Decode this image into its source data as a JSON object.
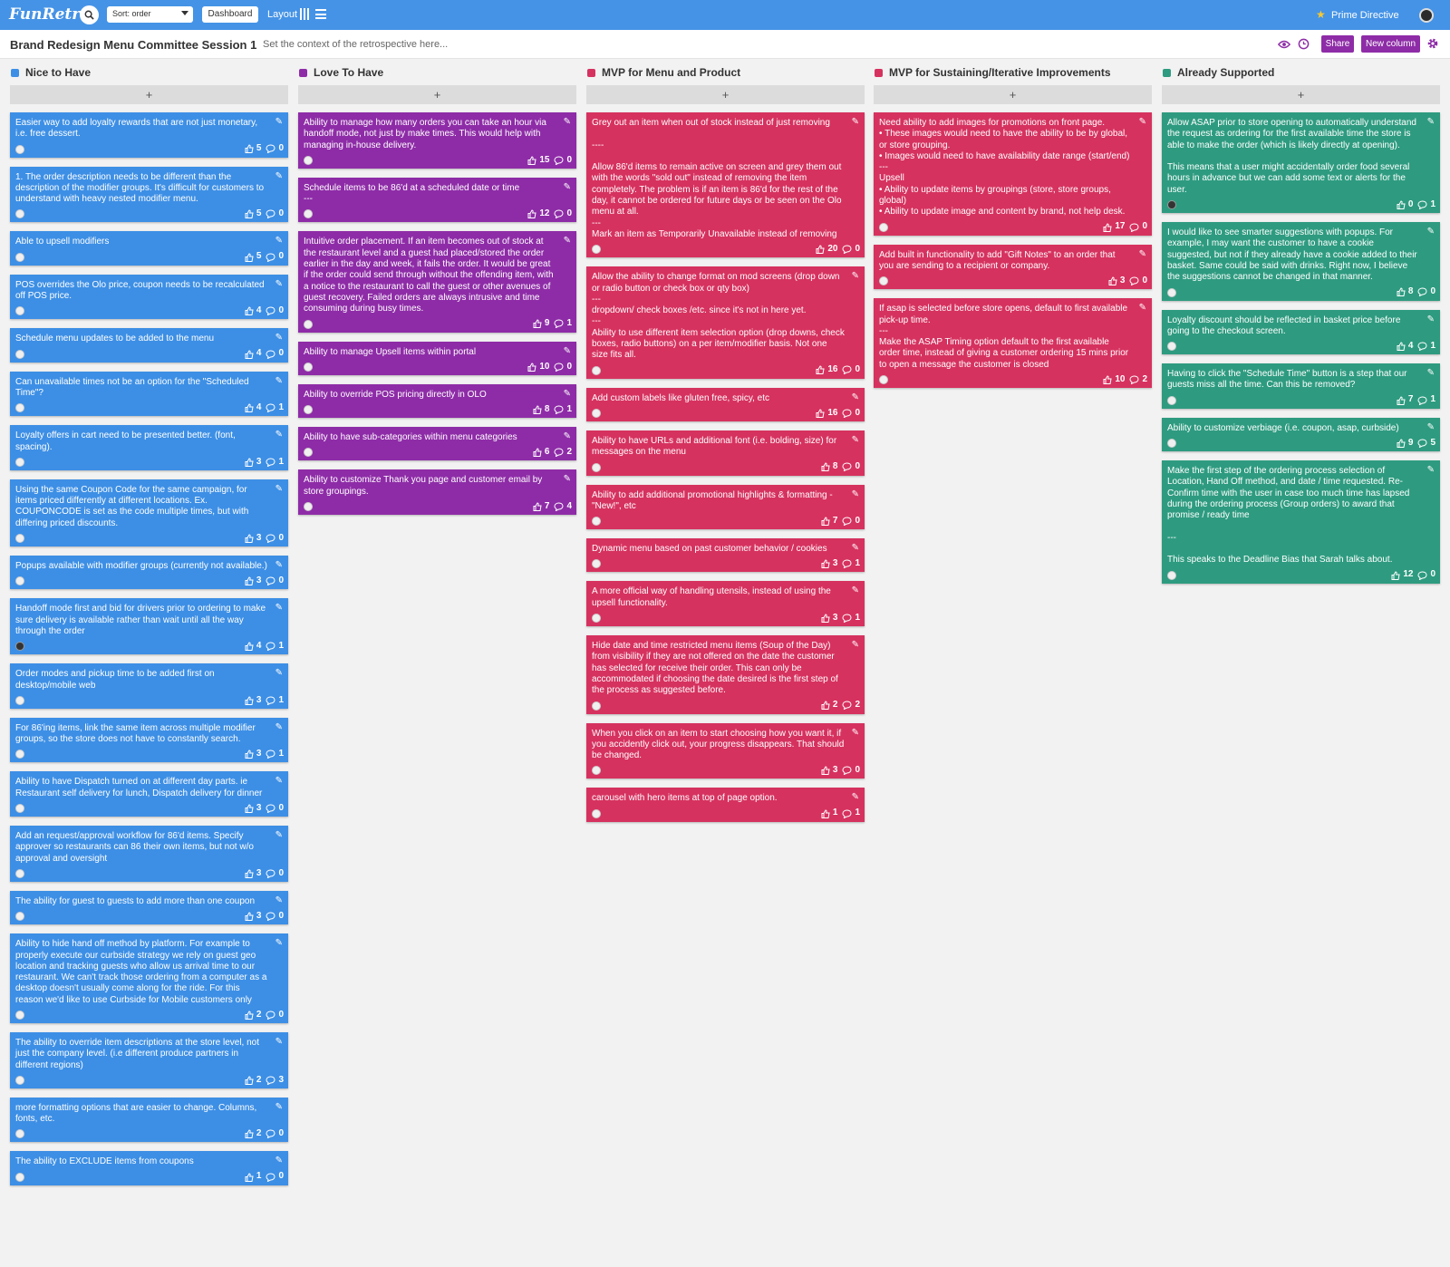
{
  "header": {
    "logo": "FunRetro",
    "sort_value": "Sort: order",
    "dashboard_label": "Dashboard",
    "layout_label": "Layout",
    "prime_directive": "Prime Directive"
  },
  "board": {
    "title": "Brand Redesign Menu Committee Session 1",
    "context_placeholder": "Set the context of the retrospective here...",
    "share_label": "Share",
    "new_column_label": "New column"
  },
  "colors": {
    "topbar": "#4593e6",
    "blue_card": "#3d8fe5",
    "purple_card": "#8e2ca7",
    "pink_card": "#d6325f",
    "teal_card": "#2e9b80"
  },
  "icons": {
    "search": "search-icon",
    "layout_columns": "columns-icon",
    "layout_rows": "rows-icon",
    "star": "star-icon",
    "eye": "eye-icon",
    "clock": "clock-icon",
    "gear": "gear-icon",
    "pencil": "pencil-icon",
    "like": "thumbs-up-icon",
    "comment": "comment-icon"
  },
  "columns": [
    {
      "title": "Nice to Have",
      "color": "#3d8fe5",
      "add_label": "+",
      "cards": [
        {
          "text": "Easier way to add loyalty rewards that are not just monetary, i.e. free dessert.",
          "likes": "5",
          "comments": "0"
        },
        {
          "text": "1. The order description needs to be different than the description of the modifier groups. It's difficult for customers to understand with heavy nested modifier menu.",
          "likes": "5",
          "comments": "0"
        },
        {
          "text": "Able to upsell modifiers",
          "likes": "5",
          "comments": "0"
        },
        {
          "text": "POS overrides the Olo price, coupon needs to be recalculated off POS price.",
          "likes": "4",
          "comments": "0"
        },
        {
          "text": "Schedule menu updates to be added to the menu",
          "likes": "4",
          "comments": "0"
        },
        {
          "text": "Can unavailable times not be an option for the \"Scheduled Time\"?",
          "likes": "4",
          "comments": "1"
        },
        {
          "text": "Loyalty offers in cart need to be presented better. (font, spacing).",
          "likes": "3",
          "comments": "1"
        },
        {
          "text": "Using the same Coupon Code for the same campaign, for items priced differently at different locations. Ex. COUPONCODE is set as the code multiple times, but with differing priced discounts.",
          "likes": "3",
          "comments": "0"
        },
        {
          "text": "Popups available with modifier groups (currently not available.)",
          "likes": "3",
          "comments": "0"
        },
        {
          "text": "Handoff mode first and bid for drivers prior to ordering to make sure delivery is available rather than wait until all the way through the order",
          "likes": "4",
          "comments": "1",
          "dark_avatar": true
        },
        {
          "text": "Order modes and pickup time to be added first on desktop/mobile web",
          "likes": "3",
          "comments": "1"
        },
        {
          "text": "For 86'ing items, link the same item across multiple modifier groups, so the store does not have to constantly search.",
          "likes": "3",
          "comments": "1"
        },
        {
          "text": "Ability to have Dispatch turned on at different day parts. ie Restaurant self delivery for lunch, Dispatch delivery for dinner",
          "likes": "3",
          "comments": "0"
        },
        {
          "text": "Add an request/approval workflow for 86'd items. Specify approver so restaurants can 86 their own items, but not w/o approval and oversight",
          "likes": "3",
          "comments": "0"
        },
        {
          "text": "The ability for guest to guests to add more than one coupon",
          "likes": "3",
          "comments": "0"
        },
        {
          "text": "Ability to hide hand off method by platform. For example to properly execute our curbside strategy we rely on guest geo location and tracking guests who allow us arrival time to our restaurant. We can't track those ordering from a computer as a desktop doesn't usually come along for the ride. For this reason we'd like to use Curbside for Mobile customers only",
          "likes": "2",
          "comments": "0"
        },
        {
          "text": "The ability to override item descriptions at the store level, not just the company level. (i.e different produce partners in different regions)",
          "likes": "2",
          "comments": "3"
        },
        {
          "text": "more formatting options that are easier to change. Columns, fonts, etc.",
          "likes": "2",
          "comments": "0"
        },
        {
          "text": "The ability to EXCLUDE items from coupons",
          "likes": "1",
          "comments": "0"
        }
      ]
    },
    {
      "title": "Love To Have",
      "color": "#8e2ca7",
      "add_label": "+",
      "cards": [
        {
          "text": "Ability to manage how many orders you can take an hour via handoff mode, not just by make times. This would help with managing in-house delivery.",
          "likes": "15",
          "comments": "0"
        },
        {
          "text": "Schedule items to be 86'd at a scheduled date or time\n---",
          "likes": "12",
          "comments": "0"
        },
        {
          "text": "Intuitive order placement. If an item becomes out of stock at the restaurant level and a guest had placed/stored the order earlier in the day and week, it fails the order. It would be great if the order could send through without the offending item, with a notice to the restaurant to call the guest or other avenues of guest recovery. Failed orders are always intrusive and time consuming during busy times.",
          "likes": "9",
          "comments": "1"
        },
        {
          "text": "Ability to manage Upsell items within portal",
          "likes": "10",
          "comments": "0"
        },
        {
          "text": "Ability to override POS pricing directly in OLO",
          "likes": "8",
          "comments": "1"
        },
        {
          "text": "Ability to have sub-categories within menu categories",
          "likes": "6",
          "comments": "2"
        },
        {
          "text": "Ability to customize Thank you page and customer email by store groupings.",
          "likes": "7",
          "comments": "4"
        }
      ]
    },
    {
      "title": "MVP for Menu and Product",
      "color": "#d6325f",
      "add_label": "+",
      "cards": [
        {
          "text": "Grey out an item when out of stock instead of just removing\n\n----\n\nAllow 86'd items to remain active on screen and grey them out with the words \"sold out\" instead of removing the item completely. The problem is if an item is 86'd for the rest of the day, it cannot be ordered for future days or be seen on the Olo menu at all.\n---\nMark an item as Temporarily Unavailable instead of removing",
          "likes": "20",
          "comments": "0"
        },
        {
          "text": "Allow the ability to change format on mod screens (drop down or radio button or check box or qty box)\n---\ndropdown/ check boxes /etc. since it's not in here yet.\n---\nAbility to use different item selection option (drop downs, check boxes, radio buttons) on a per item/modifier basis. Not one size fits all.",
          "likes": "16",
          "comments": "0"
        },
        {
          "text": "Add custom labels like gluten free, spicy, etc",
          "likes": "16",
          "comments": "0"
        },
        {
          "text": "Ability to have URLs and additional font (i.e. bolding, size) for messages on the menu",
          "likes": "8",
          "comments": "0"
        },
        {
          "text": "Ability to add additional promotional highlights & formatting - \"New!\", etc",
          "likes": "7",
          "comments": "0"
        },
        {
          "text": "Dynamic menu based on past customer behavior / cookies",
          "likes": "3",
          "comments": "1"
        },
        {
          "text": "A more official way of handling utensils, instead of using the upsell functionality.",
          "likes": "3",
          "comments": "1"
        },
        {
          "text": "Hide date and time restricted menu items (Soup of the Day) from visibility if they are not offered on the date the customer has selected for receive their order. This can only be accommodated if choosing the date desired is the first step of the process as suggested before.",
          "likes": "2",
          "comments": "2"
        },
        {
          "text": "When you click on an item to start choosing how you want it, if you accidently click out, your progress disappears. That should be changed.",
          "likes": "3",
          "comments": "0"
        },
        {
          "text": "carousel with hero items at top of page option.",
          "likes": "1",
          "comments": "1"
        }
      ]
    },
    {
      "title": "MVP for Sustaining/Iterative Improvements",
      "color": "#d6325f",
      "add_label": "+",
      "cards": [
        {
          "text": "Need ability to add images for promotions on front page.\n• These images would need to have the ability to be by global, or store grouping.\n• Images would need to have availability date range (start/end)\n---\nUpsell\n• Ability to update items by groupings (store, store groups, global)\n• Ability to update image and content by brand, not help desk.",
          "likes": "17",
          "comments": "0"
        },
        {
          "text": "Add built in functionality to add \"Gift Notes\" to an order that you are sending to a recipient or company.",
          "likes": "3",
          "comments": "0"
        },
        {
          "text": "If asap is selected before store opens, default to first available pick-up time.\n---\nMake the ASAP Timing option default to the first available order time, instead of giving a customer ordering 15 mins prior to open a message the customer is closed",
          "likes": "10",
          "comments": "2"
        }
      ]
    },
    {
      "title": "Already Supported",
      "color": "#2e9b80",
      "add_label": "+",
      "cards": [
        {
          "text": "Allow ASAP prior to store opening to automatically understand the request as ordering for the first available time the store is able to make the order (which is likely directly at opening).\n\nThis means that a user might accidentally order food several hours in advance but we can add some text or alerts for the user.",
          "likes": "0",
          "comments": "1",
          "dark_avatar": true
        },
        {
          "text": "I would like to see smarter suggestions with popups. For example, I may want the customer to have a cookie suggested, but not if they already have a cookie added to their basket. Same could be said with drinks. Right now, I believe the suggestions cannot be changed in that manner.",
          "likes": "8",
          "comments": "0"
        },
        {
          "text": "Loyalty discount should be reflected in basket price before going to the checkout screen.",
          "likes": "4",
          "comments": "1"
        },
        {
          "text": "Having to click the \"Schedule Time\" button is a step that our guests miss all the time. Can this be removed?",
          "likes": "7",
          "comments": "1"
        },
        {
          "text": "Ability to customize verbiage (i.e. coupon, asap, curbside)",
          "likes": "9",
          "comments": "5"
        },
        {
          "text": "Make the first step of the ordering process selection of Location, Hand Off method, and date / time requested. Re-Confirm time with the user in case too much time has lapsed during the ordering process (Group orders) to award that promise / ready time\n\n---\n\nThis speaks to the Deadline Bias that Sarah talks about.",
          "likes": "12",
          "comments": "0"
        }
      ]
    }
  ]
}
